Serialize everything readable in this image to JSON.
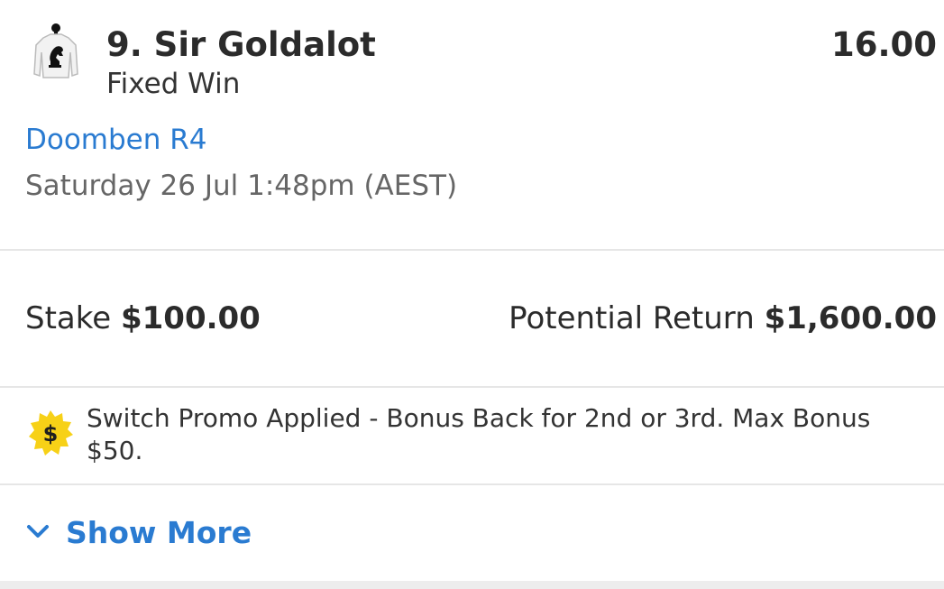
{
  "runner": {
    "name": "9. Sir Goldalot",
    "bet_type": "Fixed Win",
    "odds": "16.00",
    "silks_icon": "jockey-silks-icon"
  },
  "race": {
    "name": "Doomben R4",
    "time": "Saturday 26 Jul 1:48pm (AEST)"
  },
  "stake": {
    "label": "Stake",
    "value": "$100.00"
  },
  "potential_return": {
    "label": "Potential Return",
    "value": "$1,600.00"
  },
  "promo": {
    "icon": "dollar-badge-icon",
    "text": "Switch Promo Applied - Bonus Back for 2nd or 3rd. Max Bonus $50."
  },
  "show_more": {
    "label": "Show More",
    "icon": "chevron-down-icon"
  },
  "colors": {
    "link": "#2a7bd1",
    "text": "#2b2b2b",
    "muted": "#666666",
    "divider": "#e6e6e6",
    "badge_yellow": "#f7d117"
  }
}
